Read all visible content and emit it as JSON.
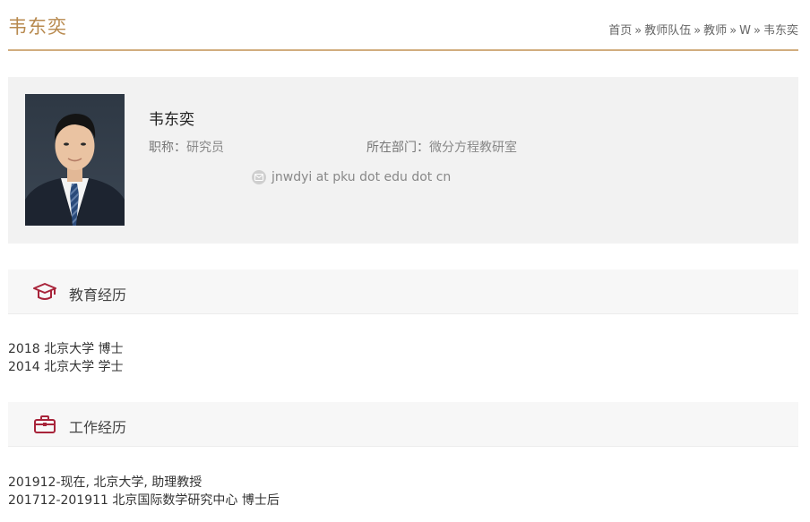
{
  "page": {
    "title": "韦东奕"
  },
  "breadcrumb": [
    "首页",
    "教师队伍",
    "教师",
    "W",
    "韦东奕"
  ],
  "breadcrumb_sep": "»",
  "profile": {
    "name": "韦东奕",
    "title_label": "职称：",
    "title_value": "研究员",
    "dept_label": "所在部门：",
    "dept_value": "微分方程教研室",
    "email": "jnwdyi at pku dot edu dot cn"
  },
  "education": {
    "heading": "教育经历",
    "items": [
      "2018 北京大学 博士",
      "2014 北京大学 学士"
    ]
  },
  "work": {
    "heading": "工作经历",
    "items": [
      "201912-现在, 北京大学, 助理教授",
      "201712-201911 北京国际数学研究中心 博士后"
    ]
  },
  "colors": {
    "accent": "#b88a4f",
    "icon_red": "#a8243a"
  },
  "icons": {
    "education": "graduation-cap-icon",
    "work": "briefcase-icon",
    "email": "mail-icon"
  }
}
